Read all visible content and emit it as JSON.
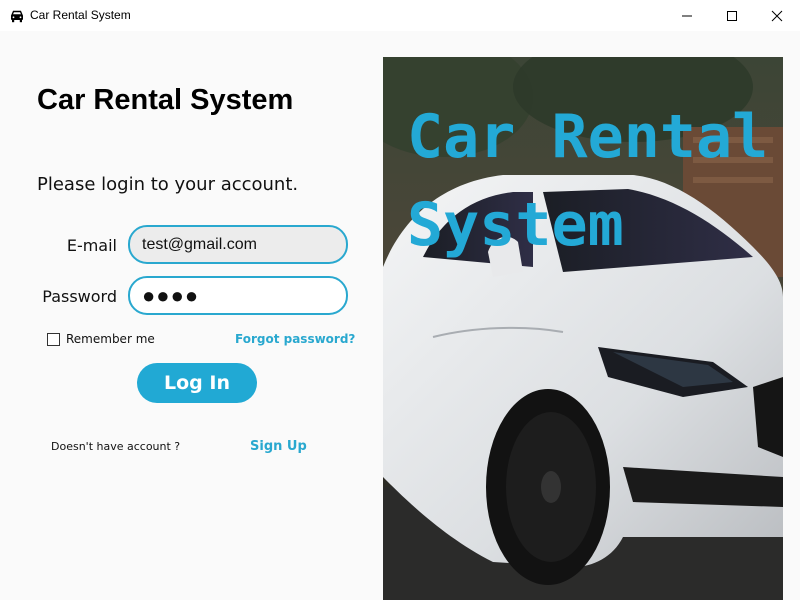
{
  "window": {
    "title": "Car Rental System",
    "controls": [
      "minimize",
      "maximize",
      "close"
    ]
  },
  "login": {
    "heading": "Car Rental System",
    "subtitle": "Please login to your account.",
    "email_label": "E-mail",
    "email_value": "test@gmail.com",
    "password_label": "Password",
    "password_value": "●●●●",
    "remember_label": "Remember me",
    "remember_checked": false,
    "forgot_label": "Forgot password?",
    "login_button": "Log In",
    "no_account_text": "Doesn't have account ?",
    "signup_label": "Sign Up"
  },
  "hero": {
    "title": "Car Rental System",
    "image": "white-sports-car-photo"
  },
  "colors": {
    "accent": "#21a9d4",
    "background": "#fafafa",
    "email_field_bg": "#ececec"
  }
}
